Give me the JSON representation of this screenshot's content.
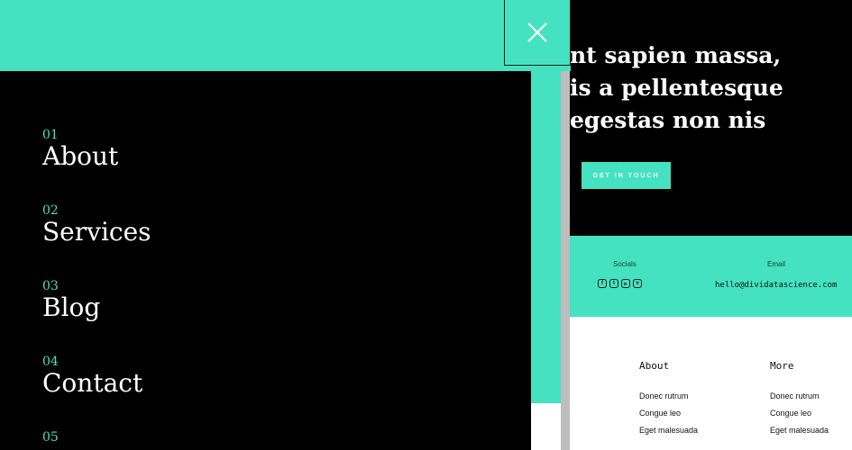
{
  "hero": {
    "lines": [
      "nt sapien massa,",
      "is a pellentesque",
      "egestas non nis"
    ],
    "cta_label": "GET IN TOUCH"
  },
  "info": {
    "socials_label": "Socials",
    "email_label": "Email",
    "email_value": "hello@dividatascience.com",
    "social_icons": [
      {
        "name": "facebook-icon",
        "glyph": "f"
      },
      {
        "name": "twitter-icon",
        "glyph": "t"
      },
      {
        "name": "youtube-icon",
        "glyph": "▸"
      },
      {
        "name": "vimeo-icon",
        "glyph": "v"
      }
    ]
  },
  "footer": {
    "about": {
      "title": "About",
      "links": [
        "Donec rutrum",
        "Congue leo",
        "Eget malesuada"
      ]
    },
    "more": {
      "title": "More",
      "links": [
        "Donec rutrum",
        "Congue leo",
        "Eget malesuada"
      ]
    }
  },
  "menu": {
    "items": [
      {
        "num": "01",
        "label": "About"
      },
      {
        "num": "02",
        "label": "Services"
      },
      {
        "num": "03",
        "label": "Blog"
      },
      {
        "num": "04",
        "label": "Contact"
      },
      {
        "num": "05",
        "label": ""
      }
    ]
  },
  "colors": {
    "accent": "#44e2c0",
    "dark": "#000000",
    "light": "#ffffff"
  },
  "icons": {
    "close": "close-icon"
  }
}
